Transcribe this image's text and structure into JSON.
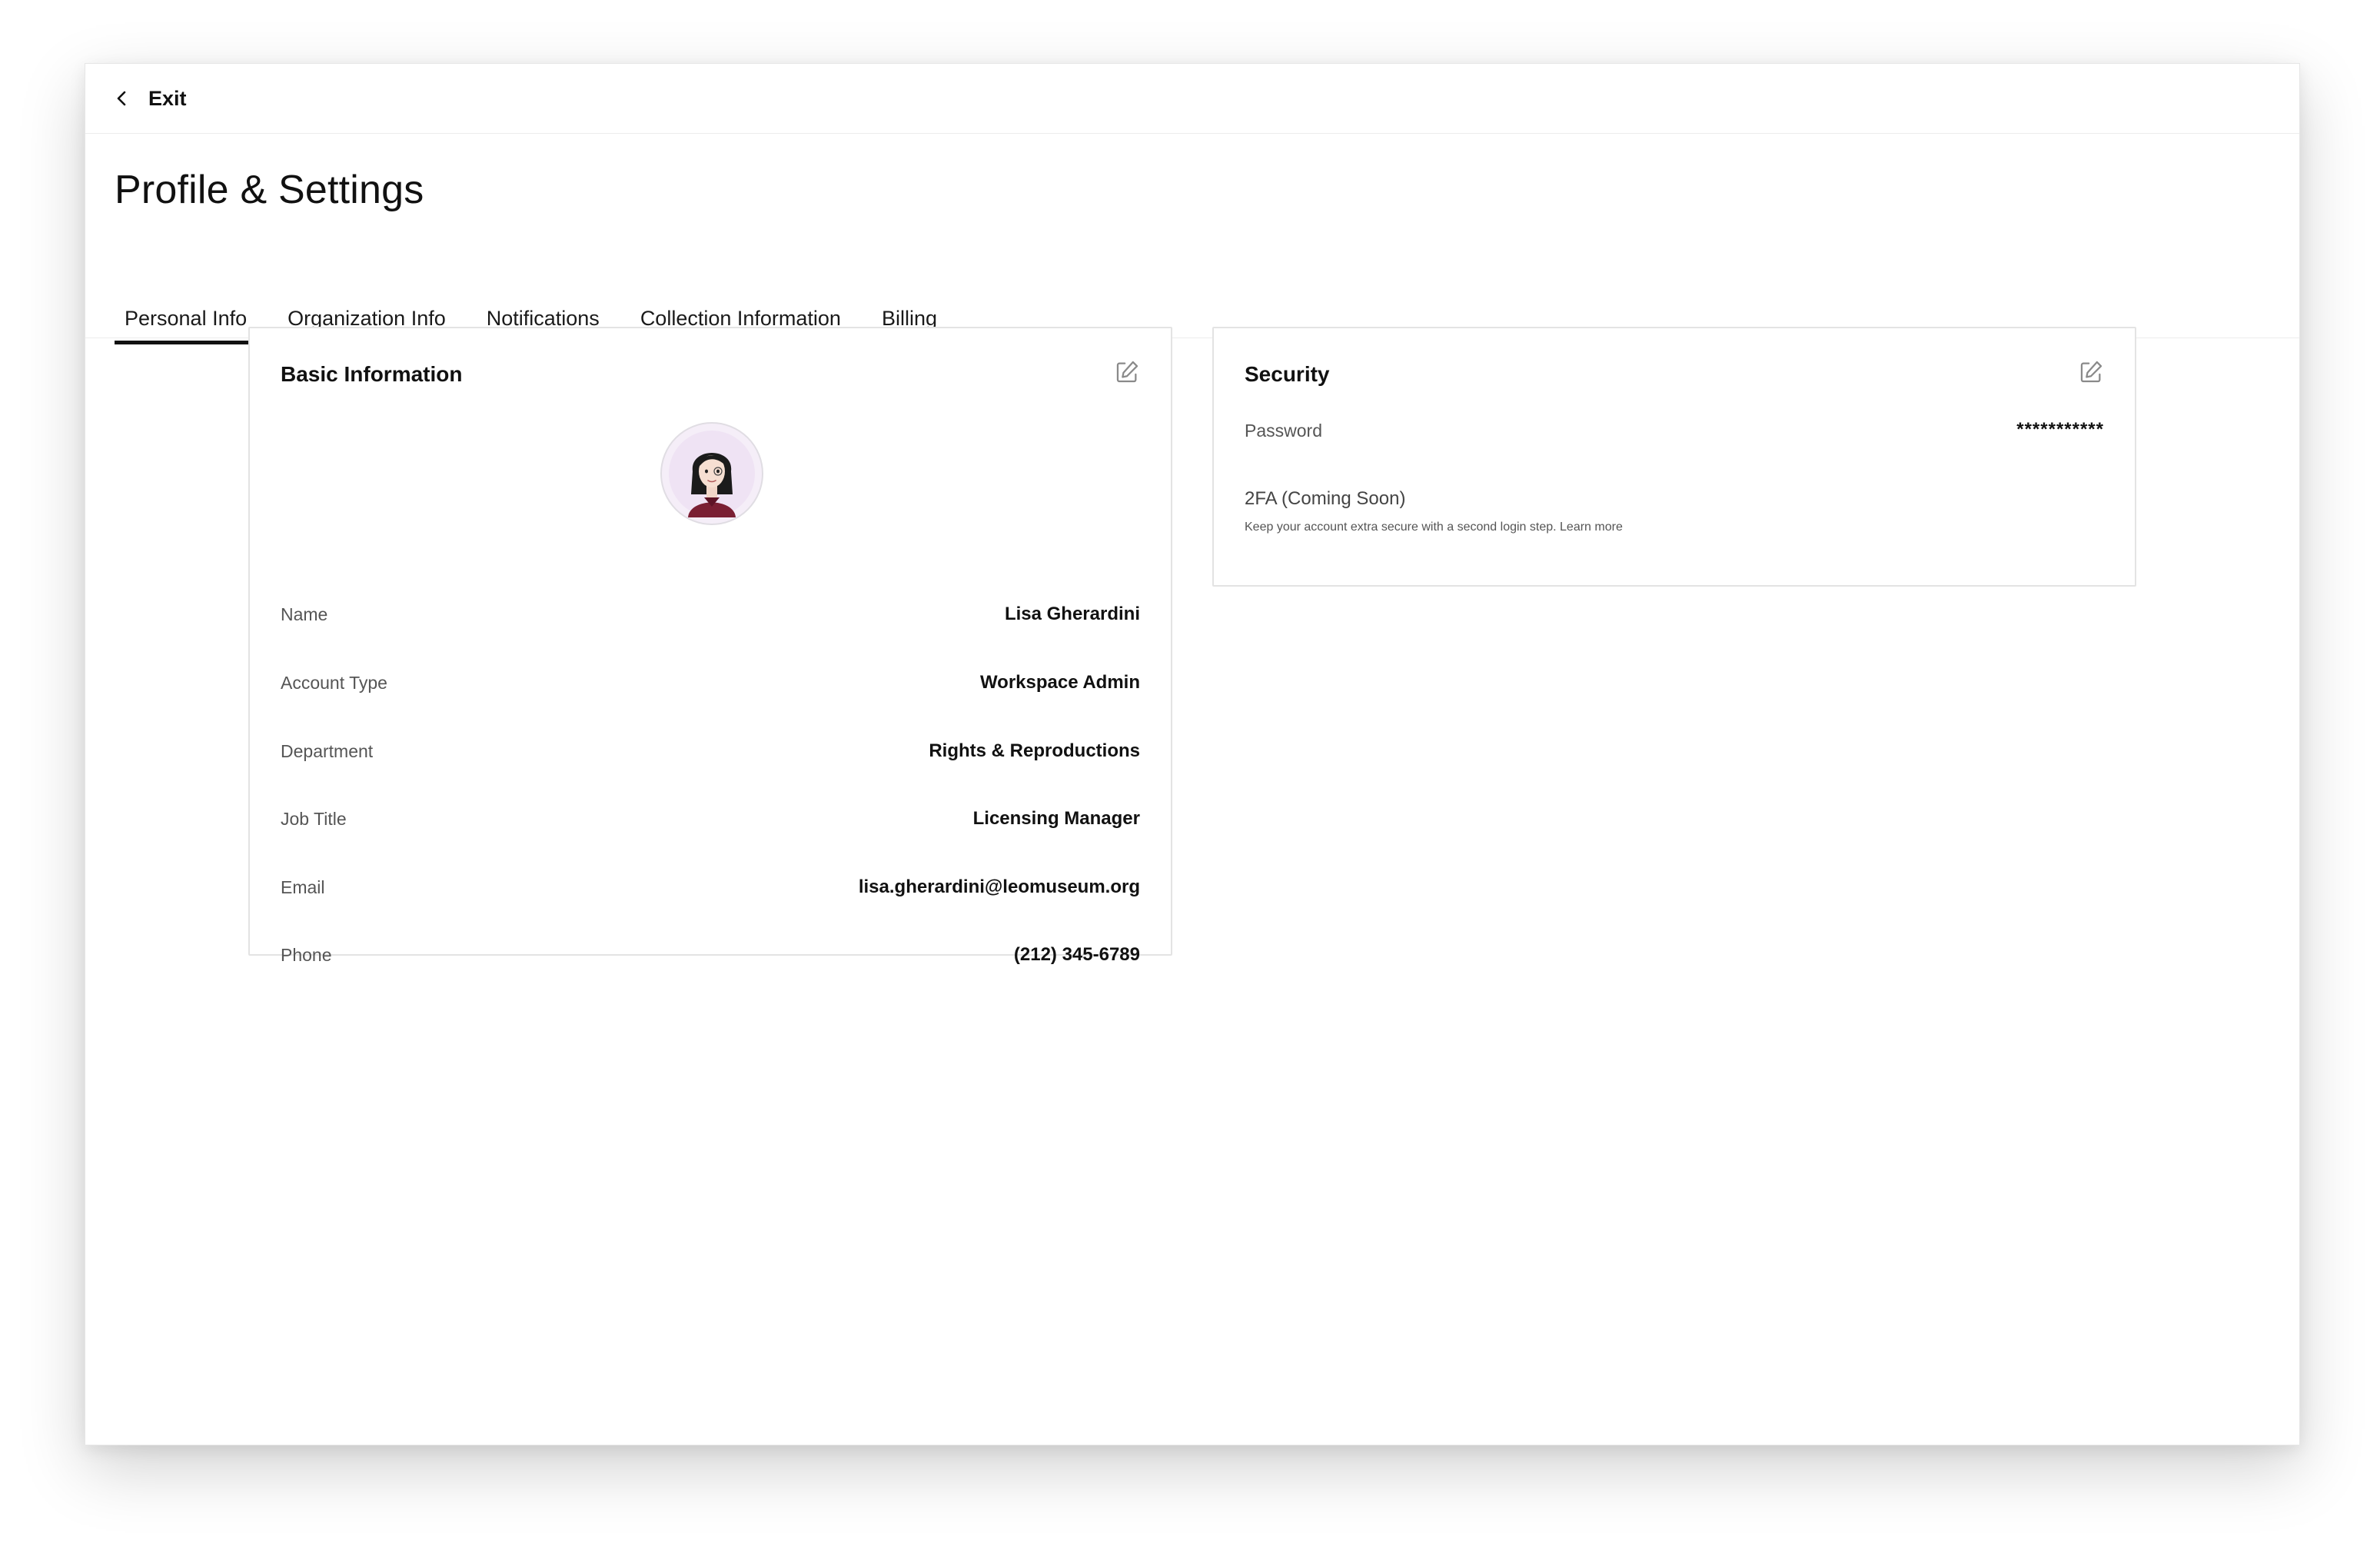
{
  "topbar": {
    "exit_label": "Exit"
  },
  "page": {
    "title": "Profile & Settings"
  },
  "tabs": [
    {
      "label": "Personal Info",
      "active": true
    },
    {
      "label": "Organization Info",
      "active": false
    },
    {
      "label": "Notifications",
      "active": false
    },
    {
      "label": "Collection Information",
      "active": false
    },
    {
      "label": "Billing",
      "active": false
    }
  ],
  "basic_info": {
    "title": "Basic Information",
    "fields": [
      {
        "label": "Name",
        "value": "Lisa Gherardini"
      },
      {
        "label": "Account Type",
        "value": "Workspace Admin"
      },
      {
        "label": "Department",
        "value": "Rights & Reproductions"
      },
      {
        "label": "Job Title",
        "value": "Licensing Manager"
      },
      {
        "label": "Email",
        "value": "lisa.gherardini@leomuseum.org"
      },
      {
        "label": "Phone",
        "value": "(212) 345-6789"
      }
    ]
  },
  "security": {
    "title": "Security",
    "password_label": "Password",
    "password_value": "***********",
    "twofa_label": "2FA (Coming Soon)",
    "twofa_description": "Keep your account extra secure with a second login step. Learn more"
  },
  "icons": {
    "exit": "chevron-left-icon",
    "edit": "edit-icon"
  }
}
